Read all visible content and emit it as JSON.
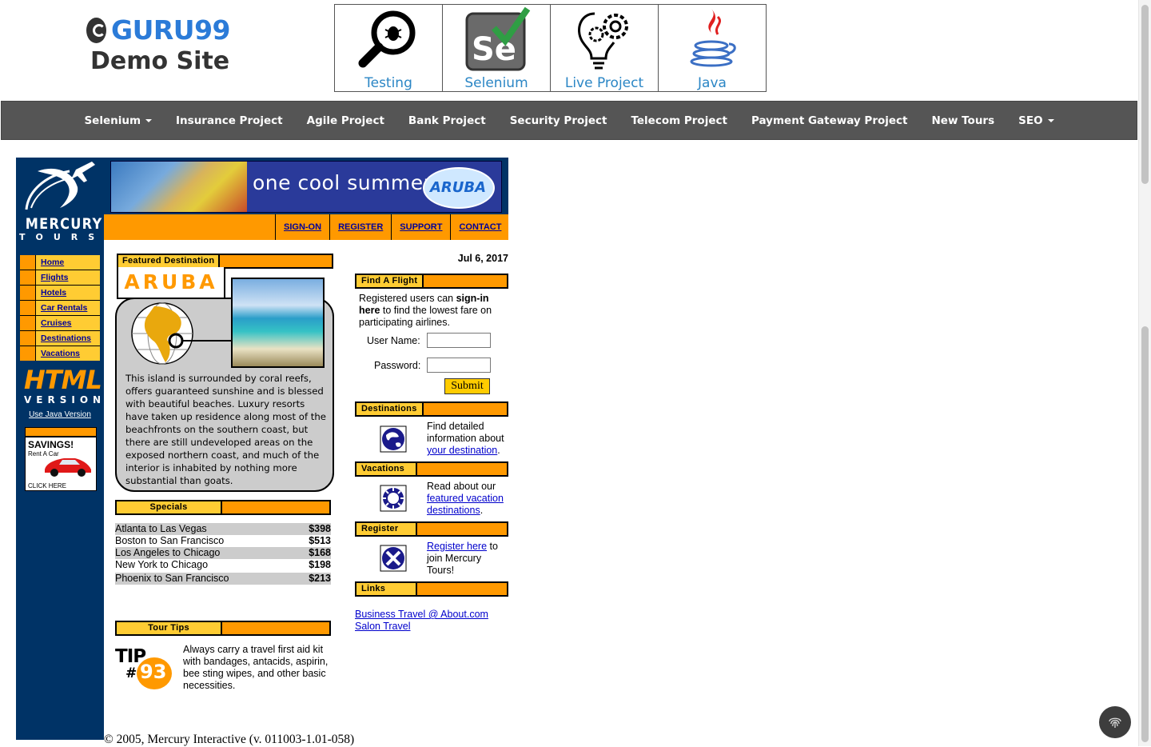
{
  "site": {
    "logo_name": "GURU99",
    "logo_sub": "Demo Site"
  },
  "course_boxes": [
    {
      "label": "Testing",
      "icon": "magnifier-bug-icon"
    },
    {
      "label": "Selenium",
      "icon": "selenium-check-icon"
    },
    {
      "label": "Live Project",
      "icon": "lightbulb-gear-icon"
    },
    {
      "label": "Java",
      "icon": "java-cup-icon"
    }
  ],
  "navbar": {
    "items": [
      "Selenium",
      "Insurance Project",
      "Agile Project",
      "Bank Project",
      "Security Project",
      "Telecom Project",
      "Payment Gateway Project",
      "New Tours",
      "SEO"
    ]
  },
  "mercury": {
    "brand": "MERCURY",
    "brand_sub": "TOURS",
    "banner_text": "one cool summer",
    "banner_logo": "ARUBA",
    "top_links": [
      "SIGN-ON",
      "REGISTER",
      "SUPPORT",
      "CONTACT"
    ],
    "left_nav": [
      "Home",
      "Flights",
      "Hotels",
      "Car Rentals",
      "Cruises",
      "Destinations",
      "Vacations"
    ],
    "html_version_1": "HTML",
    "html_version_2": "VERSION",
    "java_link": "Use Java Version",
    "ad": {
      "savings": "SAVINGS!",
      "rent": "Rent A Car",
      "click": "CLICK HERE"
    },
    "featured": {
      "header": "Featured Destination",
      "title": "ARUBA",
      "text": "This island is surrounded by coral reefs, offers guaranteed sunshine and is blessed with beautiful beaches. Luxury resorts have taken up residence along most of the beachfronts on the southern coast, but there are still undeveloped areas on the exposed northern coast, and much of the interior is inhabited by nothing more substantial than goats."
    },
    "specials": {
      "header": "Specials",
      "rows": [
        {
          "route": "Atlanta to Las Vegas",
          "price": "$398"
        },
        {
          "route": "Boston to San Francisco",
          "price": "$513"
        },
        {
          "route": "Los Angeles to Chicago",
          "price": "$168"
        },
        {
          "route": "New York to Chicago",
          "price": "$198"
        },
        {
          "route": "Phoenix to San Francisco",
          "price": "$213"
        }
      ]
    },
    "tour_tips": {
      "header": "Tour Tips",
      "tip_label": "TIP",
      "tip_hash": "#",
      "tip_number": "93",
      "text": "Always carry a travel first aid kit with bandages, antacids, aspirin, bee sting wipes, and other basic necessities."
    },
    "date": "Jul 6, 2017",
    "find_flight": {
      "header": "Find A Flight",
      "intro_1": "Registered users can ",
      "intro_bold": "sign-in here",
      "intro_2": " to find the lowest fare on participating airlines.",
      "username_label": "User Name:",
      "password_label": "Password:",
      "username_value": "",
      "password_value": "",
      "submit": "Submit"
    },
    "destinations": {
      "header": "Destinations",
      "text": "Find detailed information about ",
      "link": "your destination",
      "after": "."
    },
    "vacations": {
      "header": "Vacations",
      "text": "Read about our ",
      "link": "featured vacation destinations",
      "after": "."
    },
    "register": {
      "header": "Register",
      "link": "Register here",
      "text": " to join Mercury Tours!"
    },
    "links": {
      "header": "Links",
      "items": [
        "Business Travel @ About.com",
        "Salon Travel"
      ]
    },
    "footer": "© 2005, Mercury Interactive (v. 011003-1.01-058)"
  },
  "colors": {
    "orange": "#ff9900",
    "yellow": "#ffcc33",
    "navy": "#003366",
    "nav_bg": "#555555",
    "guru_blue": "#2b7bd8"
  }
}
